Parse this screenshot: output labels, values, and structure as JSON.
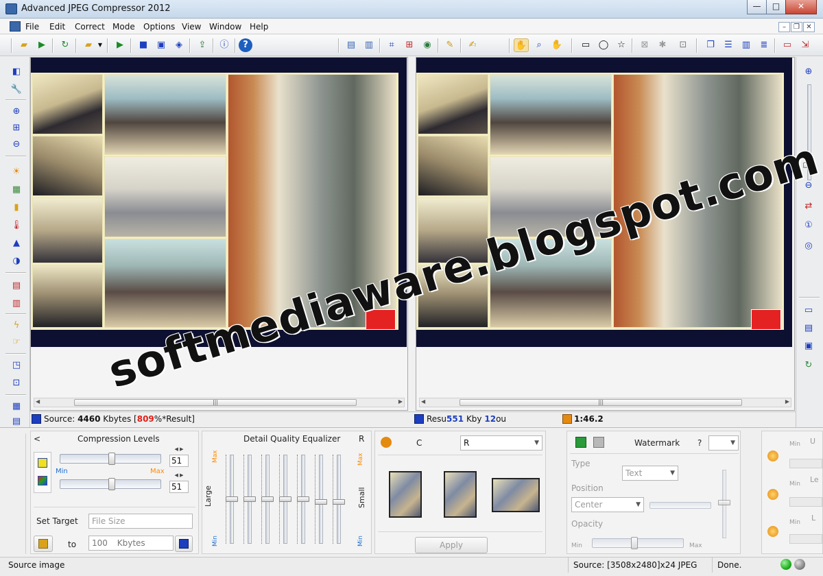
{
  "window": {
    "title": "Advanced JPEG Compressor 2012",
    "min": "—",
    "max": "□",
    "close": "✕"
  },
  "menu": [
    "File",
    "Edit",
    "Correct",
    "Mode",
    "Options",
    "View",
    "Window",
    "Help"
  ],
  "mdi": {
    "min": "–",
    "restore": "❐",
    "close": "✕"
  },
  "info": {
    "source_prefix": "Source: ",
    "source_value": "4460",
    "source_unit": " Kbytes  [",
    "percent": "809",
    "percent_suffix": "%*Result]",
    "result_prefix": "Resu",
    "result_value": "551",
    "result_mid": "Kby",
    "result_v2": "12",
    "result_tail": "ou",
    "time": "1:46.2"
  },
  "compression": {
    "collapse": "<",
    "title": "Compression Levels",
    "value1": "51",
    "value2": "51",
    "min_label": "Min",
    "max_label": "Max",
    "set_target": "Set Target",
    "target_placeholder": "File Size",
    "to_label": "to",
    "target_value": "100",
    "unit": "Kbytes",
    "slider1": 0.51,
    "slider2": 0.51
  },
  "equalizer": {
    "title": "Detail Quality Equalizer",
    "reset": "R",
    "max": "Max",
    "min": "Min",
    "large": "Large",
    "small": "Small",
    "max_right": "Max",
    "min_right": "Min"
  },
  "presets": {
    "label": "C",
    "combo": "R",
    "apply": "Apply"
  },
  "watermark": {
    "title": "Watermark",
    "help": "?",
    "type_label": "Type",
    "type_value": "Text",
    "position_label": "Position",
    "position_value": "Center",
    "opacity_label": "Opacity",
    "min": "Min",
    "max": "Max",
    "opacity": 0.45
  },
  "right_group": {
    "min1": "Min",
    "u": "U",
    "min2": "Min",
    "l": "Le",
    "min3": "Min",
    "l2": "L"
  },
  "status": {
    "left": "Source image",
    "middle": "Source: [3508x2480]x24 JPEG",
    "right": "Done."
  },
  "colors": {
    "accent_red": "#e0201a",
    "accent_blue": "#1d3fbf",
    "orange": "#ff8a00",
    "led_green": "#22b022",
    "led_grey": "#8a8a8a"
  },
  "overlay": {
    "text": "softmediaware.blogspot.com"
  }
}
